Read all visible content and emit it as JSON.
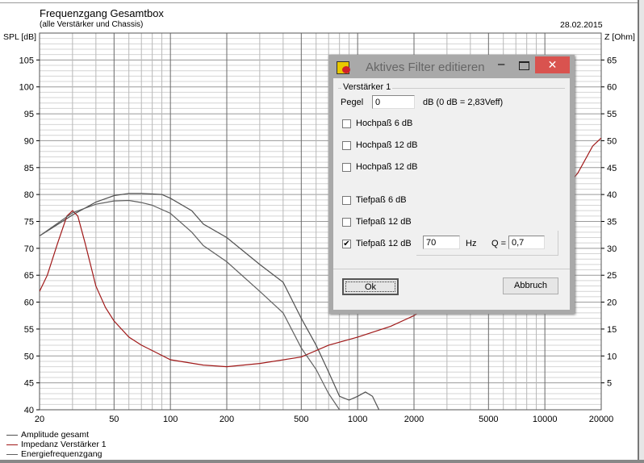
{
  "header": {
    "title": "Frequenzgang Gesamtbox",
    "subtitle": "(alle Verstärker und Chassis)",
    "date": "28.02.2015"
  },
  "chart_data": {
    "type": "line",
    "title": "Frequenzgang Gesamtbox",
    "subtitle": "(alle Verstärker und Chassis)",
    "xscale": "log",
    "xlim": [
      20,
      20000
    ],
    "x_ticks": [
      20,
      50,
      100,
      200,
      500,
      1000,
      2000,
      5000,
      10000,
      20000
    ],
    "ylabel": "SPL [dB]",
    "ylim": [
      40,
      110
    ],
    "y_ticks": [
      40,
      45,
      50,
      55,
      60,
      65,
      70,
      75,
      80,
      85,
      90,
      95,
      100,
      105
    ],
    "y2label": "Z [Ohm]",
    "y2lim": [
      0,
      70
    ],
    "y2_ticks": [
      5,
      10,
      15,
      20,
      25,
      30,
      35,
      40,
      45,
      50,
      55,
      60,
      65
    ],
    "grid": true,
    "legend": "bottom-left",
    "series": [
      {
        "name": "Amplitude gesamt",
        "axis": "left",
        "color": "#505050",
        "x": [
          20,
          30,
          40,
          50,
          60,
          70,
          80,
          90,
          100,
          130,
          150,
          200,
          300,
          400,
          500,
          600,
          700,
          800,
          900,
          1000,
          1100,
          1200,
          1300
        ],
        "y": [
          72.3,
          76.2,
          78.6,
          79.8,
          80.2,
          80.2,
          80.1,
          80,
          79.3,
          77,
          74.5,
          72,
          67,
          63.7,
          57,
          52,
          47,
          42.5,
          41.8,
          42.5,
          43.3,
          42.5,
          40
        ]
      },
      {
        "name": "Impedanz Verstärker 1",
        "axis": "right",
        "color": "#a01818",
        "x": [
          20,
          22,
          25,
          28,
          30,
          32,
          35,
          40,
          45,
          50,
          60,
          70,
          80,
          100,
          150,
          200,
          300,
          500,
          700,
          1000,
          1500,
          2000,
          3000,
          5000,
          8000,
          12000,
          15000,
          18000,
          20000
        ],
        "y": [
          22,
          25,
          31,
          36,
          37,
          36,
          31,
          23,
          19,
          16.5,
          13.5,
          12,
          11,
          9.3,
          8.3,
          8,
          8.6,
          9.8,
          12,
          13.5,
          15.5,
          17.5,
          22,
          28,
          34,
          40,
          44,
          49,
          50.5
        ]
      },
      {
        "name": "Energiefrequenzgang",
        "axis": "left",
        "color": "#606060",
        "x": [
          20,
          30,
          40,
          50,
          60,
          70,
          80,
          100,
          130,
          150,
          200,
          300,
          400,
          500,
          600,
          700,
          800
        ],
        "y": [
          72.3,
          76.6,
          78.2,
          78.8,
          78.9,
          78.5,
          78,
          76.5,
          73,
          70.5,
          67.5,
          62,
          58,
          51.5,
          47.5,
          43,
          40
        ]
      }
    ]
  },
  "legend": [
    "Amplitude gesamt",
    "Impedanz Verstärker 1",
    "Energiefrequenzgang"
  ],
  "dialog": {
    "title": "Aktives Filter editieren",
    "close": "✕",
    "minimize": "–",
    "group": "Verstärker 1",
    "pegel_label": "Pegel",
    "pegel_value": "0",
    "pegel_unit": "dB (0 dB = 2,83Veff)",
    "options": [
      {
        "label": "Hochpaß 6 dB",
        "checked": false
      },
      {
        "label": "Hochpaß 12 dB",
        "checked": false
      },
      {
        "label": "Hochpaß 12 dB",
        "checked": false
      },
      {
        "label": "Tiefpaß 6 dB",
        "checked": false
      },
      {
        "label": "Tiefpaß 12 dB",
        "checked": false
      },
      {
        "label": "Tiefpaß 12 dB",
        "checked": true
      }
    ],
    "check": "✔",
    "freq_value": "70",
    "freq_unit": "Hz",
    "q_label": "Q =",
    "q_value": "0,7",
    "ok": "Ok",
    "cancel": "Abbruch"
  }
}
